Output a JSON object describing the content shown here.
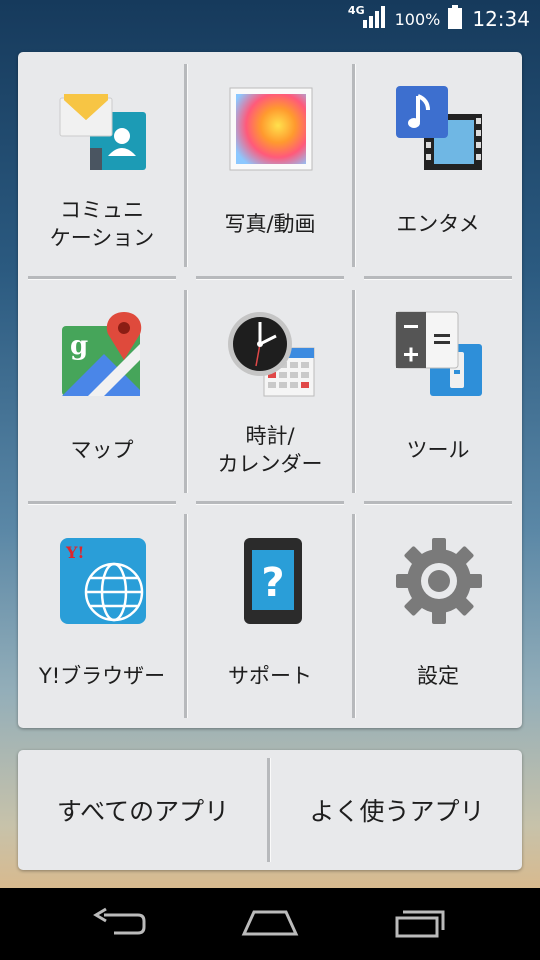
{
  "status_bar": {
    "network": "4G",
    "battery_percent": "100%",
    "time": "12:34",
    "icons": [
      "signal-icon",
      "battery-icon"
    ]
  },
  "grid": {
    "items": [
      {
        "label": "コミュニ\nケーション",
        "icon": "communication-icon"
      },
      {
        "label": "写真/動画",
        "icon": "photo-video-icon"
      },
      {
        "label": "エンタメ",
        "icon": "entertainment-icon"
      },
      {
        "label": "マップ",
        "icon": "maps-icon"
      },
      {
        "label": "時計/\nカレンダー",
        "icon": "clock-calendar-icon"
      },
      {
        "label": "ツール",
        "icon": "tools-icon"
      },
      {
        "label": "Y!ブラウザー",
        "icon": "yahoo-browser-icon"
      },
      {
        "label": "サポート",
        "icon": "support-icon"
      },
      {
        "label": "設定",
        "icon": "settings-icon"
      }
    ]
  },
  "bottom": {
    "all_apps_label": "すべてのアプリ",
    "frequent_apps_label": "よく使うアプリ"
  },
  "navigation": {
    "icons": [
      "back-icon",
      "home-icon",
      "recents-icon"
    ]
  }
}
